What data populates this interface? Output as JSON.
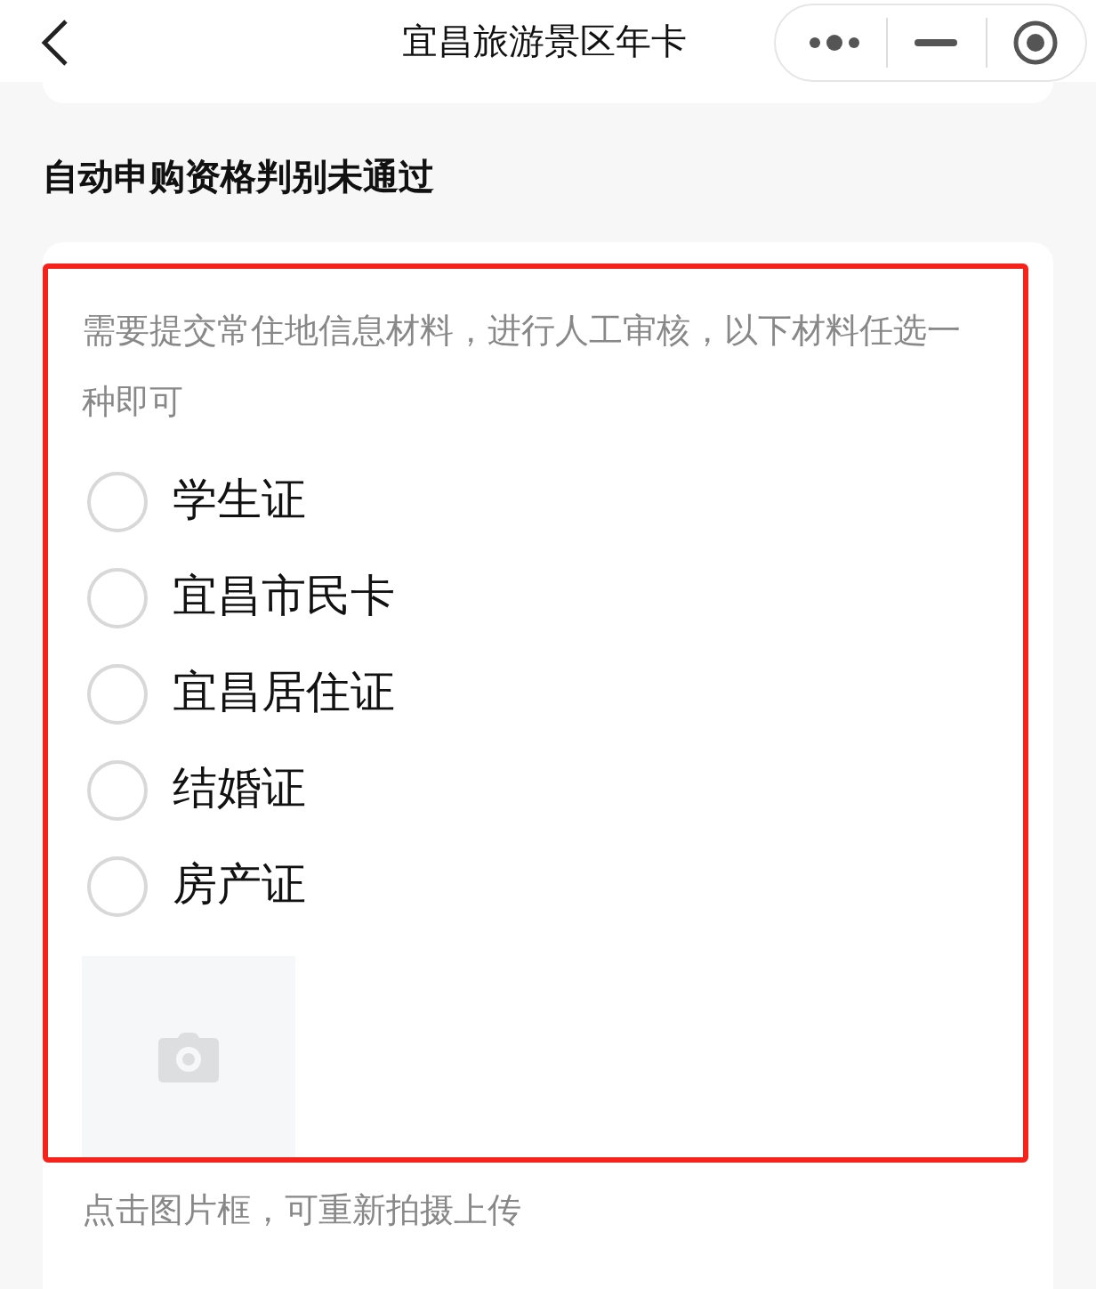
{
  "header": {
    "title": "宜昌旅游景区年卡"
  },
  "section_title": "自动申购资格判别未通过",
  "description": "需要提交常住地信息材料，进行人工审核，以下材料任选一种即可",
  "options": [
    {
      "label": "学生证",
      "selected": false
    },
    {
      "label": "宜昌市民卡",
      "selected": false
    },
    {
      "label": "宜昌居住证",
      "selected": false
    },
    {
      "label": "结婚证",
      "selected": false
    },
    {
      "label": "房产证",
      "selected": false
    }
  ],
  "hint": "点击图片框，可重新拍摄上传"
}
